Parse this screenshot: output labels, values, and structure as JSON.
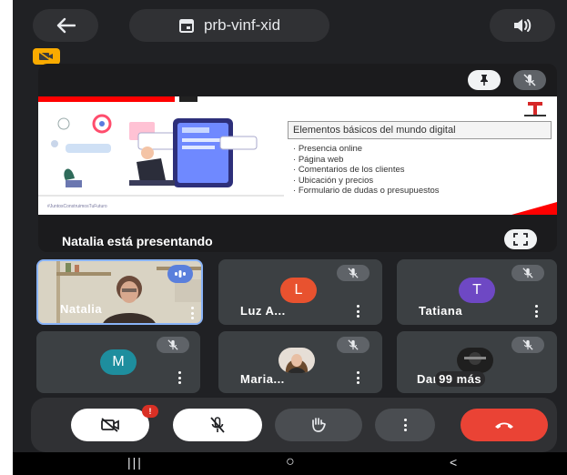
{
  "header": {
    "meeting_code": "prb-vinf-xid",
    "back_icon": "arrow-left-icon",
    "calendar_icon": "calendar-icon",
    "speaker_icon": "speaker-icon"
  },
  "camera_warning_icon": "camera-off-icon",
  "presentation": {
    "caption": "Natalia está presentando",
    "slide": {
      "title": "Elementos básicos del mundo digital",
      "bullets": [
        "Presencia online",
        "Página web",
        "Comentarios de los clientes",
        "Ubicación y precios",
        "Formulario de dudas o presupuestos"
      ],
      "footer": "#JuntosConstruimosTuFuturo"
    }
  },
  "participants": [
    {
      "name": "Natalia",
      "avatar": "video"
    },
    {
      "name": "Luz A...",
      "initial": "L",
      "color": "#e8522f"
    },
    {
      "name": "Tatiana",
      "initial": "T",
      "color": "#6e48c4"
    },
    {
      "initial": "M",
      "color": "#1e8e9e"
    },
    {
      "name": "Maria...",
      "avatar": "photo"
    },
    {
      "name": "Dan",
      "overflow": "99 más"
    }
  ],
  "controls": {
    "camera_badge": "!",
    "items": [
      "camera-off-icon",
      "mic-off-icon",
      "raise-hand-icon",
      "more-options-icon",
      "end-call-icon"
    ]
  },
  "nav": {
    "recents": "|||",
    "home": "○",
    "back": "<"
  }
}
